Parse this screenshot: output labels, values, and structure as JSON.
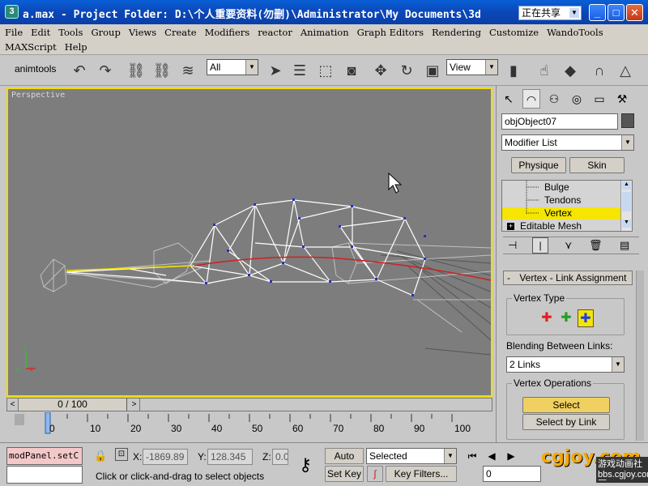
{
  "window": {
    "title": "a.max   - Project Folder: D:\\个人重要资料(勿删)\\Administrator\\My Documents\\3d",
    "ime_label": "正在共享",
    "app_icon": "3"
  },
  "menu": {
    "row1": [
      "File",
      "Edit",
      "Tools",
      "Group",
      "Views",
      "Create",
      "Modifiers",
      "reactor",
      "Animation",
      "Graph Editors",
      "Rendering",
      "Customize",
      "WandoTools"
    ],
    "row2": [
      "MAXScript",
      "Help"
    ]
  },
  "toolbar": {
    "animtools_label": "animtools",
    "selection_filter": "All",
    "ref_coord": "View"
  },
  "viewport": {
    "label": "Perspective"
  },
  "timeslider": {
    "frame_display": "0 / 100",
    "prev": "<",
    "next": ">"
  },
  "trackbar": {
    "ticks": [
      "0",
      "10",
      "20",
      "30",
      "40",
      "50",
      "60",
      "70",
      "80",
      "90",
      "100"
    ]
  },
  "command_panel": {
    "object_name": "objObject07",
    "modifier_list": "Modifier List",
    "physique_label": "Physique",
    "skin_label": "Skin",
    "stack_items": [
      {
        "label": "Bulge",
        "selected": false
      },
      {
        "label": "Tendons",
        "selected": false
      },
      {
        "label": "Vertex",
        "selected": true
      },
      {
        "label": "Editable Mesh",
        "selected": false
      }
    ],
    "rollout_title": "Vertex - Link Assignment",
    "rollout_toggle": "-",
    "vertex_type_label": "Vertex Type",
    "vertex_type_colors": [
      "#e02020",
      "#20a020",
      "#2040e0"
    ],
    "blending_label": "Blending Between Links:",
    "blending_value": "2 Links",
    "vertex_ops_label": "Vertex Operations",
    "select_label": "Select",
    "select_by_link_label": "Select by Link"
  },
  "status": {
    "listener_text": "modPanel.setC",
    "x_label": "X:",
    "x_value": "-1869.89",
    "y_label": "Y:",
    "y_value": "128.345",
    "z_label": "Z:",
    "z_value": "0.0",
    "auto_key": "Auto Key",
    "set_key": "Set Key",
    "key_mode": "Selected",
    "key_filters": "Key Filters...",
    "current_frame": "0",
    "prompt": "Click or click-and-drag to select objects"
  },
  "watermark": {
    "logo": "cgjoy.com",
    "cn": "游戏动画社区",
    "url": "bbs.cgjoy.com"
  }
}
